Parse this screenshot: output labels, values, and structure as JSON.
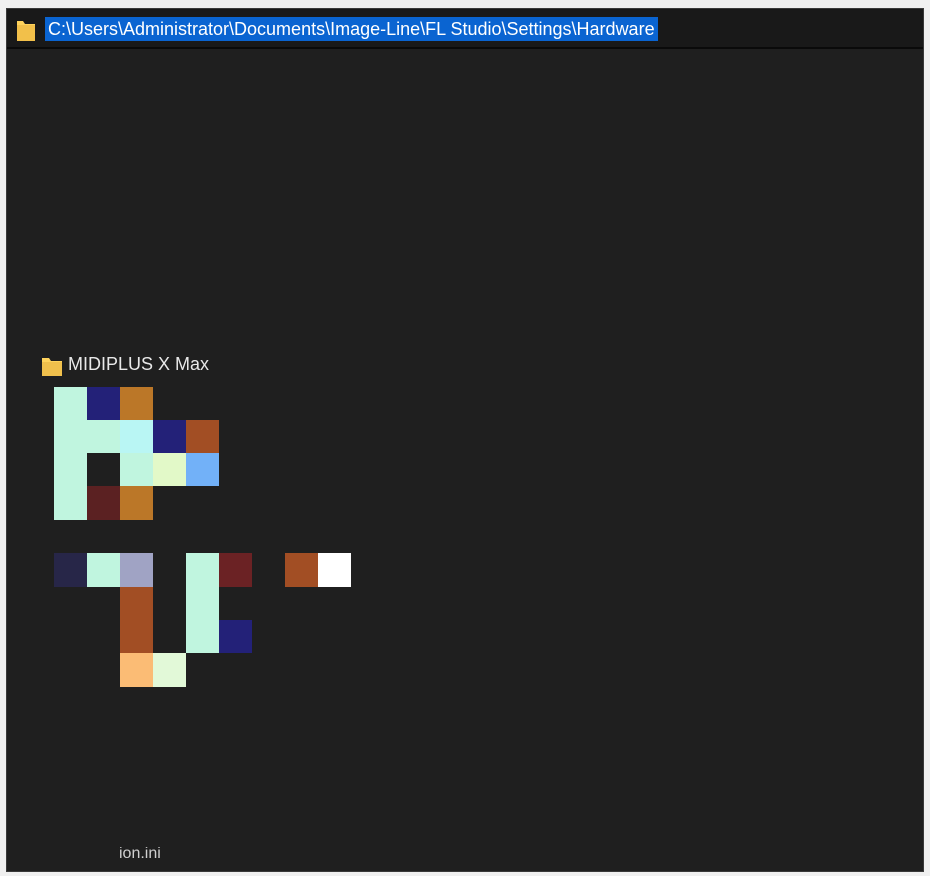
{
  "address_bar": {
    "path": "C:\\Users\\Administrator\\Documents\\Image-Line\\FL Studio\\Settings\\Hardware",
    "icon": "folder-icon"
  },
  "items": [
    {
      "label": "MIDIPLUS X Max",
      "icon": "folder-icon"
    }
  ],
  "partial_file": {
    "label": "ion.ini"
  },
  "colors": {
    "window_bg": "#1f1f1f",
    "selection": "#0a64d1",
    "folder_yellow": "#ffd35c"
  }
}
